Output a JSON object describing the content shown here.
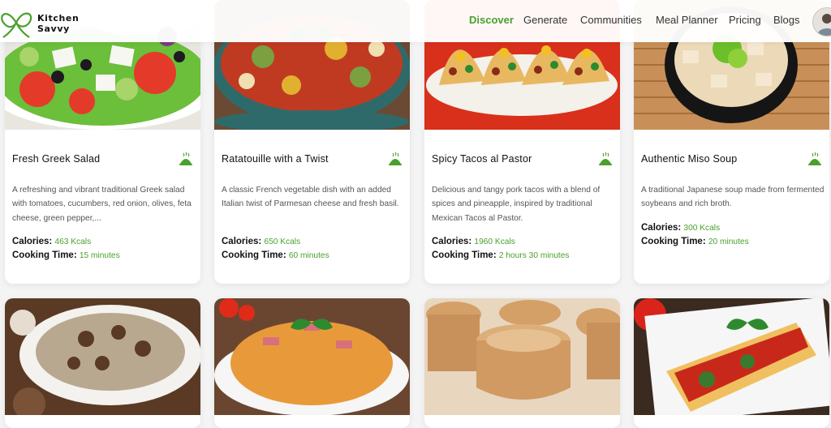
{
  "brand": {
    "name_line1": "Kitchen",
    "name_line2": "Savvy",
    "accent": "#4aa02c"
  },
  "nav": {
    "items": [
      {
        "label": "Discover",
        "active": true
      },
      {
        "label": "Generate",
        "active": false
      },
      {
        "label": "Communities",
        "active": false
      },
      {
        "label": "Meal Planner",
        "active": false
      },
      {
        "label": "Pricing",
        "active": false
      },
      {
        "label": "Blogs",
        "active": false
      }
    ]
  },
  "labels": {
    "calories": "Calories:",
    "cooking_time": "Cooking Time:"
  },
  "recipes": [
    {
      "title": "Fresh Greek Salad",
      "description": "A refreshing and vibrant traditional Greek salad with tomatoes, cucumbers, red onion, olives, feta cheese, green pepper,...",
      "calories": "463 Kcals",
      "cooking_time": "15 minutes",
      "image": "greek-salad-photo"
    },
    {
      "title": "Ratatouille with a Twist",
      "description": "A classic French vegetable dish with an added Italian twist of Parmesan cheese and fresh basil.",
      "calories": "650 Kcals",
      "cooking_time": "60 minutes",
      "image": "ratatouille-photo"
    },
    {
      "title": "Spicy Tacos al Pastor",
      "description": "Delicious and tangy pork tacos with a blend of spices and pineapple, inspired by traditional Mexican Tacos al Pastor.",
      "calories": "1960 Kcals",
      "cooking_time": "2 hours 30 minutes",
      "image": "tacos-photo"
    },
    {
      "title": "Authentic Miso Soup",
      "description": "A traditional Japanese soup made from fermented soybeans and rich broth.",
      "calories": "300 Kcals",
      "cooking_time": "20 minutes",
      "image": "miso-soup-photo"
    }
  ],
  "more_recipes": [
    {
      "image": "mushroom-soup-photo"
    },
    {
      "image": "spaghetti-photo"
    },
    {
      "image": "pudding-photo"
    },
    {
      "image": "cannelloni-photo"
    }
  ],
  "icons": {
    "veg": "veg-dish-icon",
    "logo": "leaf-logo-icon",
    "avatar": "user-avatar"
  }
}
